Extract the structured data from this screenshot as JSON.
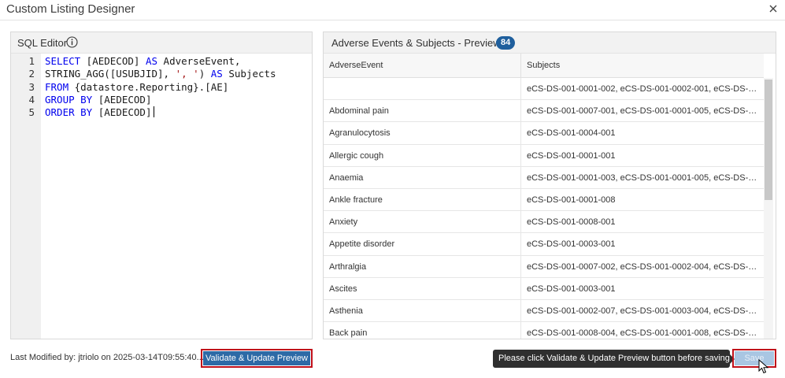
{
  "window": {
    "title": "Custom Listing Designer"
  },
  "sql_editor": {
    "title": "SQL Editor",
    "line_numbers": [
      "1",
      "2",
      "3",
      "4",
      "5"
    ],
    "lines": [
      {
        "tokens": [
          {
            "t": "SELECT",
            "k": "kw"
          },
          {
            "t": " [AEDECOD] ",
            "k": ""
          },
          {
            "t": "AS",
            "k": "kw"
          },
          {
            "t": " AdverseEvent,",
            "k": ""
          }
        ]
      },
      {
        "tokens": [
          {
            "t": "STRING_AGG([USUBJID], ",
            "k": ""
          },
          {
            "t": "', '",
            "k": "str"
          },
          {
            "t": ") ",
            "k": ""
          },
          {
            "t": "AS",
            "k": "kw"
          },
          {
            "t": " Subjects",
            "k": ""
          }
        ]
      },
      {
        "tokens": [
          {
            "t": "FROM",
            "k": "kw"
          },
          {
            "t": " {datastore.Reporting}.[AE]",
            "k": ""
          }
        ]
      },
      {
        "tokens": [
          {
            "t": "GROUP BY",
            "k": "kw"
          },
          {
            "t": " [AEDECOD]",
            "k": ""
          }
        ]
      },
      {
        "tokens": [
          {
            "t": "ORDER BY",
            "k": "kw"
          },
          {
            "t": " [AEDECOD]",
            "k": ""
          }
        ]
      }
    ]
  },
  "preview": {
    "title": "Adverse Events & Subjects - Preview",
    "count": "84",
    "columns": [
      "AdverseEvent",
      "Subjects"
    ],
    "rows": [
      [
        "",
        "eCS-DS-001-0001-002, eCS-DS-001-0002-001, eCS-DS-001-0..."
      ],
      [
        "Abdominal pain",
        "eCS-DS-001-0007-001, eCS-DS-001-0001-005, eCS-DS-001-0..."
      ],
      [
        "Agranulocytosis",
        "eCS-DS-001-0004-001"
      ],
      [
        "Allergic cough",
        "eCS-DS-001-0001-001"
      ],
      [
        "Anaemia",
        "eCS-DS-001-0001-003, eCS-DS-001-0001-005, eCS-DS-001-0..."
      ],
      [
        "Ankle fracture",
        "eCS-DS-001-0001-008"
      ],
      [
        "Anxiety",
        "eCS-DS-001-0008-001"
      ],
      [
        "Appetite disorder",
        "eCS-DS-001-0003-001"
      ],
      [
        "Arthralgia",
        "eCS-DS-001-0007-002, eCS-DS-001-0002-004, eCS-DS-001-0..."
      ],
      [
        "Ascites",
        "eCS-DS-001-0003-001"
      ],
      [
        "Asthenia",
        "eCS-DS-001-0002-007, eCS-DS-001-0003-004, eCS-DS-001-0..."
      ],
      [
        "Back pain",
        "eCS-DS-001-0008-004, eCS-DS-001-0001-008, eCS-DS-001-0..."
      ]
    ]
  },
  "footer": {
    "last_modified": "Last Modified by: jtriolo on 2025-03-14T09:55:40...",
    "validate_label": "Validate & Update Preview",
    "tooltip": "Please click Validate & Update Preview button before saving",
    "save_label": "Save"
  },
  "colors": {
    "accent": "#2d6aa6",
    "badge": "#1f5f9d",
    "highlight_border": "#c0101a",
    "keyword": "#0000ee",
    "string": "#a31515"
  },
  "icons": {
    "close": "close-icon",
    "info": "info-icon",
    "pointer": "mouse-pointer-icon"
  }
}
